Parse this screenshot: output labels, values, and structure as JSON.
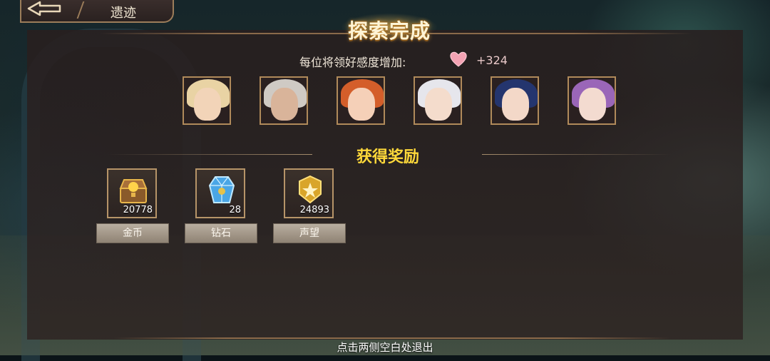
{
  "header": {
    "back_icon": "back-arrow-icon",
    "title": "遗迹"
  },
  "banner": {
    "title": "探索完成"
  },
  "affinity": {
    "label": "每位将领好感度增加:",
    "icon": "heart-icon",
    "value": "+324",
    "heart_color": "#f4a3b4"
  },
  "generals": [
    {
      "name": "general-1",
      "hair": "#e9d3a4",
      "face": "#f2d4b8"
    },
    {
      "name": "general-2",
      "hair": "#cfcac4",
      "face": "#d9b49a"
    },
    {
      "name": "general-3",
      "hair": "#d45e2a",
      "face": "#f5d0b8"
    },
    {
      "name": "general-4",
      "hair": "#e6e6ec",
      "face": "#f4dccc"
    },
    {
      "name": "general-5",
      "hair": "#24356e",
      "face": "#f3d8c8"
    },
    {
      "name": "general-6",
      "hair": "#9a66b8",
      "face": "#f3dbd0"
    }
  ],
  "rewards": {
    "title": "获得奖励",
    "items": [
      {
        "label": "金币",
        "count": "20778",
        "icon": "treasure-chest-icon"
      },
      {
        "label": "钻石",
        "count": "28",
        "icon": "crystal-icon"
      },
      {
        "label": "声望",
        "count": "24893",
        "icon": "prestige-badge-icon"
      }
    ]
  },
  "footer": {
    "hint": "点击两侧空白处退出"
  },
  "colors": {
    "reward_title": "#ffd93a",
    "frame": "#b08a5a"
  }
}
